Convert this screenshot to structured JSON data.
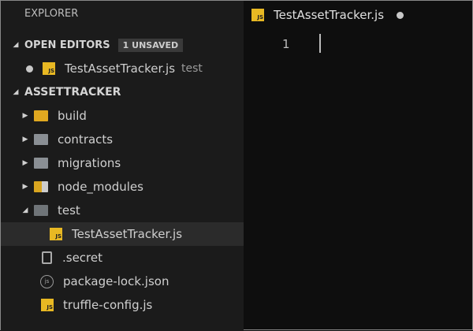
{
  "sidebar": {
    "title": "EXPLORER",
    "open_editors": {
      "label": "OPEN EDITORS",
      "badge": "1 UNSAVED",
      "items": [
        {
          "name": "TestAssetTracker.js",
          "folder": "test"
        }
      ]
    },
    "project": {
      "label": "ASSETTRACKER",
      "items": [
        {
          "name": "build",
          "icon": "folder-build-icon"
        },
        {
          "name": "contracts",
          "icon": "folder-icon"
        },
        {
          "name": "migrations",
          "icon": "folder-icon"
        },
        {
          "name": "node_modules",
          "icon": "folder-node-icon"
        },
        {
          "name": "test",
          "icon": "folder-test-icon"
        },
        {
          "name": "TestAssetTracker.js",
          "icon": "js-file-icon"
        },
        {
          "name": ".secret",
          "icon": "file-icon"
        },
        {
          "name": "package-lock.json",
          "icon": "nodejs-icon"
        },
        {
          "name": "truffle-config.js",
          "icon": "js-file-icon"
        }
      ]
    }
  },
  "editor": {
    "tab": "TestAssetTracker.js",
    "js_badge": "JS",
    "line_numbers": [
      "1"
    ]
  },
  "colors": {
    "js": "#e8b823",
    "folder": "#8a8f94"
  }
}
